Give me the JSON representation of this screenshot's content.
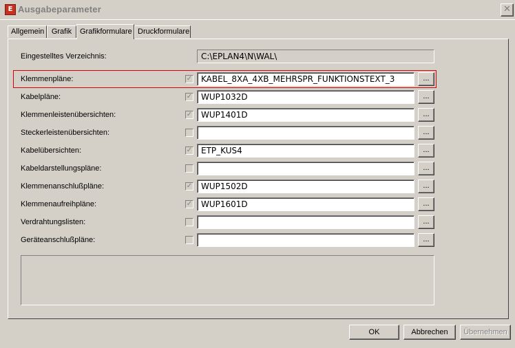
{
  "window": {
    "title": "Ausgabeparameter",
    "app_icon": "eplan-app-icon",
    "close_glyph": "✕"
  },
  "tabs": [
    {
      "label": "Allgemein"
    },
    {
      "label": "Grafik"
    },
    {
      "label": "Grafikformulare",
      "active": true
    },
    {
      "label": "Druckformulare"
    }
  ],
  "directory": {
    "label": "Eingestelltes Verzeichnis:",
    "value": "C:\\EPLAN4\\N\\WAL\\"
  },
  "rows": [
    {
      "label": "Klemmenpläne:",
      "checked": true,
      "value": "KABEL_8XA_4XB_MEHRSPR_FUNKTIONSTEXT_3",
      "browse": "...",
      "highlighted": true
    },
    {
      "label": "Kabelpläne:",
      "checked": true,
      "value": "WUP1032D",
      "browse": "..."
    },
    {
      "label": "Klemmenleistenübersichten:",
      "checked": true,
      "value": "WUP1401D",
      "browse": "..."
    },
    {
      "label": "Steckerleistenübersichten:",
      "checked": false,
      "value": "",
      "browse": "..."
    },
    {
      "label": "Kabelübersichten:",
      "checked": true,
      "value": "ETP_KUS4",
      "browse": "..."
    },
    {
      "label": "Kabeldarstellungspläne:",
      "checked": false,
      "value": "",
      "browse": "..."
    },
    {
      "label": "Klemmenanschlußpläne:",
      "checked": true,
      "value": "WUP1502D",
      "browse": "..."
    },
    {
      "label": "Klemmenaufreihpläne:",
      "checked": true,
      "value": "WUP1601D",
      "browse": "..."
    },
    {
      "label": "Verdrahtungslisten:",
      "checked": false,
      "value": "",
      "browse": "..."
    },
    {
      "label": "Geräteanschlußpläne:",
      "checked": false,
      "value": "",
      "browse": "..."
    }
  ],
  "check_glyph": "✓",
  "buttons": {
    "ok": "OK",
    "cancel": "Abbrechen",
    "apply": "Übernehmen"
  },
  "colors": {
    "face": "#d4d0c8",
    "highlight_border": "#d80000",
    "disabled_text": "#808080"
  }
}
